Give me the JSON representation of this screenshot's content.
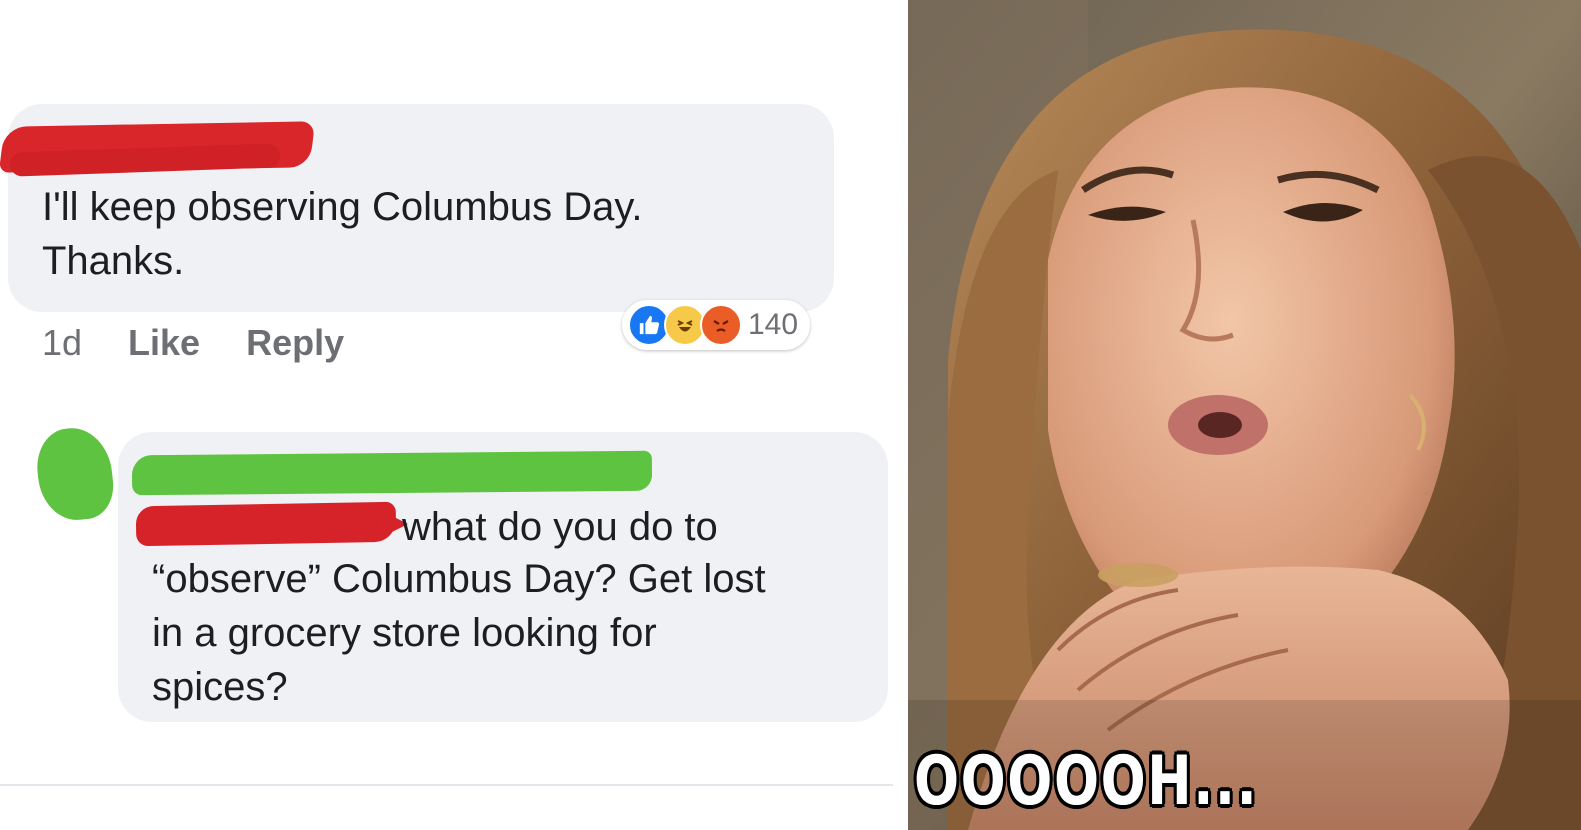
{
  "comments": [
    {
      "author_redacted": true,
      "text": "I'll keep observing Columbus Day.\nThanks.",
      "time": "1d",
      "like_label": "Like",
      "reply_label": "Reply",
      "reaction_icons": [
        "like-icon",
        "haha-icon",
        "angry-icon"
      ],
      "reaction_count": "140"
    },
    {
      "author_redacted": true,
      "mention_redacted": true,
      "text_first_line": "what do you do to",
      "text_rest": "“observe” Columbus Day? Get lost\nin a grocery store looking for\nspices?"
    }
  ],
  "image": {
    "caption": "OOOOOH..."
  },
  "colors": {
    "bubble": "#f0f1f5",
    "redaction_red": "#d9262a",
    "redaction_green": "#5ec341",
    "meta_text": "#6d6f75",
    "like_blue": "#1877f2"
  }
}
